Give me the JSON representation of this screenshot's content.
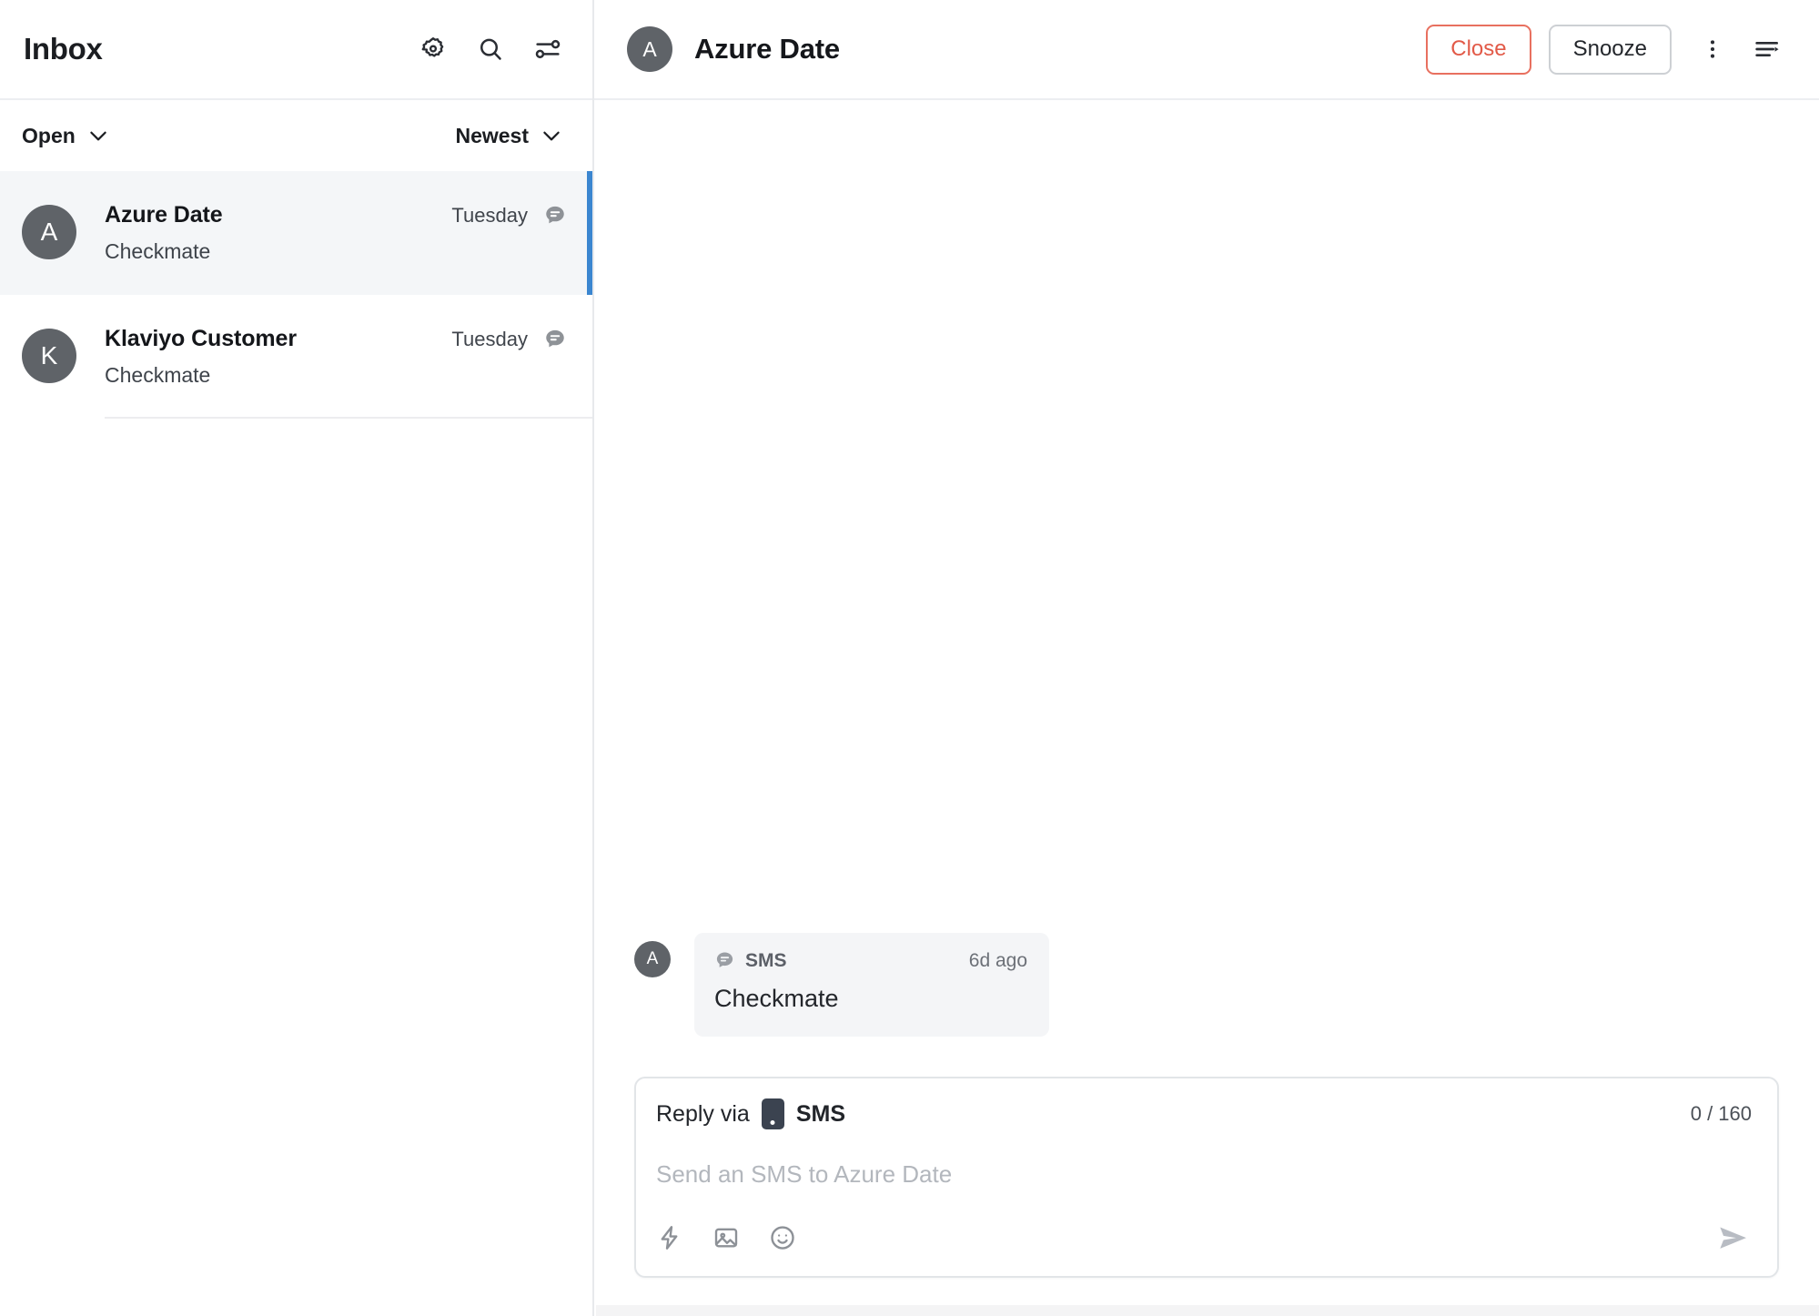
{
  "sidebar": {
    "title": "Inbox",
    "header_icons": [
      {
        "name": "settings-gear-icon",
        "label": "Settings"
      },
      {
        "name": "search-icon",
        "label": "Search"
      },
      {
        "name": "filter-sliders-icon",
        "label": "Filters"
      }
    ],
    "filters": {
      "status_label": "Open",
      "sort_label": "Newest"
    },
    "threads": [
      {
        "avatar_initial": "A",
        "name": "Azure Date",
        "time": "Tuesday",
        "preview": "Checkmate",
        "channel_icon": "sms-bubble-icon",
        "selected": true
      },
      {
        "avatar_initial": "K",
        "name": "Klaviyo Customer",
        "time": "Tuesday",
        "preview": "Checkmate",
        "channel_icon": "sms-bubble-icon",
        "selected": false
      }
    ]
  },
  "main": {
    "header": {
      "avatar_initial": "A",
      "title": "Azure Date",
      "close_label": "Close",
      "snooze_label": "Snooze",
      "more_icon": "kebab-menu-icon",
      "details_icon": "conversation-details-icon"
    },
    "messages": [
      {
        "avatar_initial": "A",
        "channel": "SMS",
        "channel_icon": "sms-bubble-icon",
        "time": "6d ago",
        "text": "Checkmate"
      }
    ],
    "composer": {
      "reply_via_label": "Reply via",
      "channel_name": "SMS",
      "channel_icon": "phone-icon",
      "char_count": "0 / 160",
      "placeholder": "Send an SMS to Azure Date",
      "tools": [
        {
          "name": "quick-reply-lightning-icon"
        },
        {
          "name": "attach-image-icon"
        },
        {
          "name": "emoji-icon"
        }
      ],
      "send_icon": "send-paper-plane-icon"
    }
  },
  "colors": {
    "accent_selected": "#3b86d0",
    "close_red": "#e25a48",
    "avatar_bg": "#5f6368",
    "bubble_bg": "#f4f5f7",
    "selected_row_bg": "#f4f6f8"
  }
}
